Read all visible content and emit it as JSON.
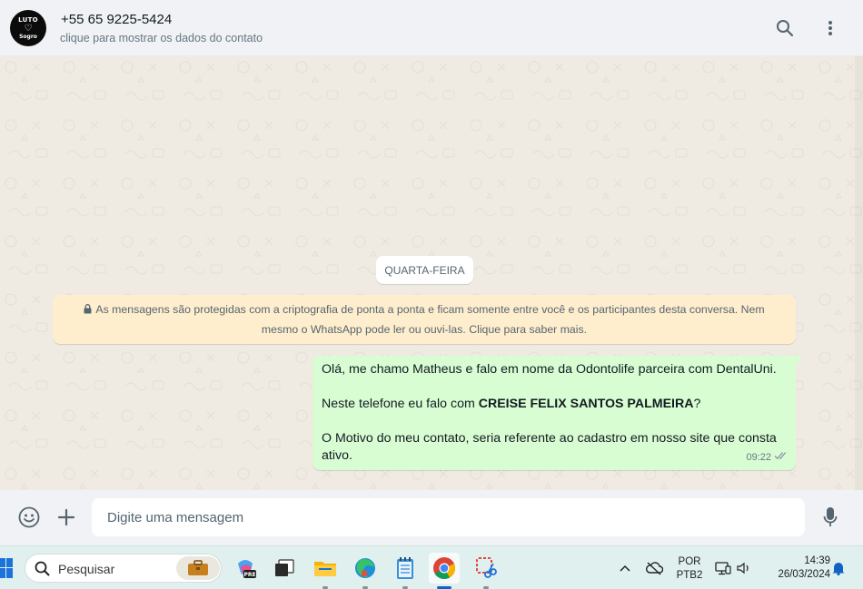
{
  "header": {
    "avatar": {
      "line1": "LUTO",
      "line2": "Sogro"
    },
    "contact_name": "+55 65 9225-5424",
    "contact_subtitle": "clique para mostrar os dados do contato",
    "icons": [
      "search-icon",
      "more-options-icon"
    ]
  },
  "chat": {
    "day_label": "QUARTA-FEIRA",
    "encryption_notice": "As mensagens são protegidas com a criptografia de ponta a ponta e ficam somente entre você e os participantes desta conversa. Nem mesmo o WhatsApp pode ler ou ouvi-las. Clique para saber mais.",
    "message": {
      "line1": "Olá, me chamo Matheus e falo em nome da Odontolife parceira com DentalUni.",
      "line2_prefix": "Neste telefone eu falo com ",
      "line2_bold": "CREISE FELIX SANTOS PALMEIRA",
      "line2_suffix": "?",
      "line3": "O Motivo do meu contato, seria referente ao cadastro em nosso site que consta ativo.",
      "time": "09:22",
      "status": "delivered-double-check"
    }
  },
  "composer": {
    "placeholder": "Digite uma mensagem",
    "icons": [
      "emoji-icon",
      "attach-plus-icon",
      "microphone-icon"
    ]
  },
  "taskbar": {
    "search_label": "Pesquisar",
    "apps": [
      "copilot-pre-icon",
      "task-view-icon",
      "file-explorer-icon",
      "edge-icon",
      "notepad-icon",
      "chrome-icon",
      "snipping-tool-icon"
    ],
    "active_app": "chrome-icon",
    "language": {
      "line1": "POR",
      "line2": "PTB2"
    },
    "time": "14:39",
    "date": "26/03/2024",
    "colors": {
      "accent": "#1063c4",
      "bubble_out": "#d9fdd3",
      "notice_bg": "#ffeecd"
    }
  }
}
